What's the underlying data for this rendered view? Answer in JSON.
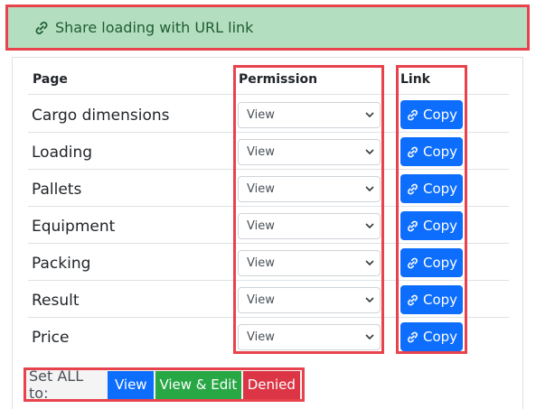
{
  "header": {
    "title": "Share loading with URL link",
    "icon": "link-icon"
  },
  "table": {
    "headers": [
      "Page",
      "Permission",
      "Link"
    ],
    "rows": [
      {
        "page": "Cargo dimensions",
        "permission": "View",
        "link_label": "Copy"
      },
      {
        "page": "Loading",
        "permission": "View",
        "link_label": "Copy"
      },
      {
        "page": "Pallets",
        "permission": "View",
        "link_label": "Copy"
      },
      {
        "page": "Equipment",
        "permission": "View",
        "link_label": "Copy"
      },
      {
        "page": "Packing",
        "permission": "View",
        "link_label": "Copy"
      },
      {
        "page": "Result",
        "permission": "View",
        "link_label": "Copy"
      },
      {
        "page": "Price",
        "permission": "View",
        "link_label": "Copy"
      }
    ]
  },
  "set_all": {
    "label": "Set ALL to:",
    "view": "View",
    "view_edit": "View & Edit",
    "denied": "Denied"
  },
  "colors": {
    "primary": "#0d6efd",
    "success": "#28a745",
    "danger": "#dc3545",
    "highlight": "#e8434d",
    "header_bg": "#b3dfc0"
  }
}
